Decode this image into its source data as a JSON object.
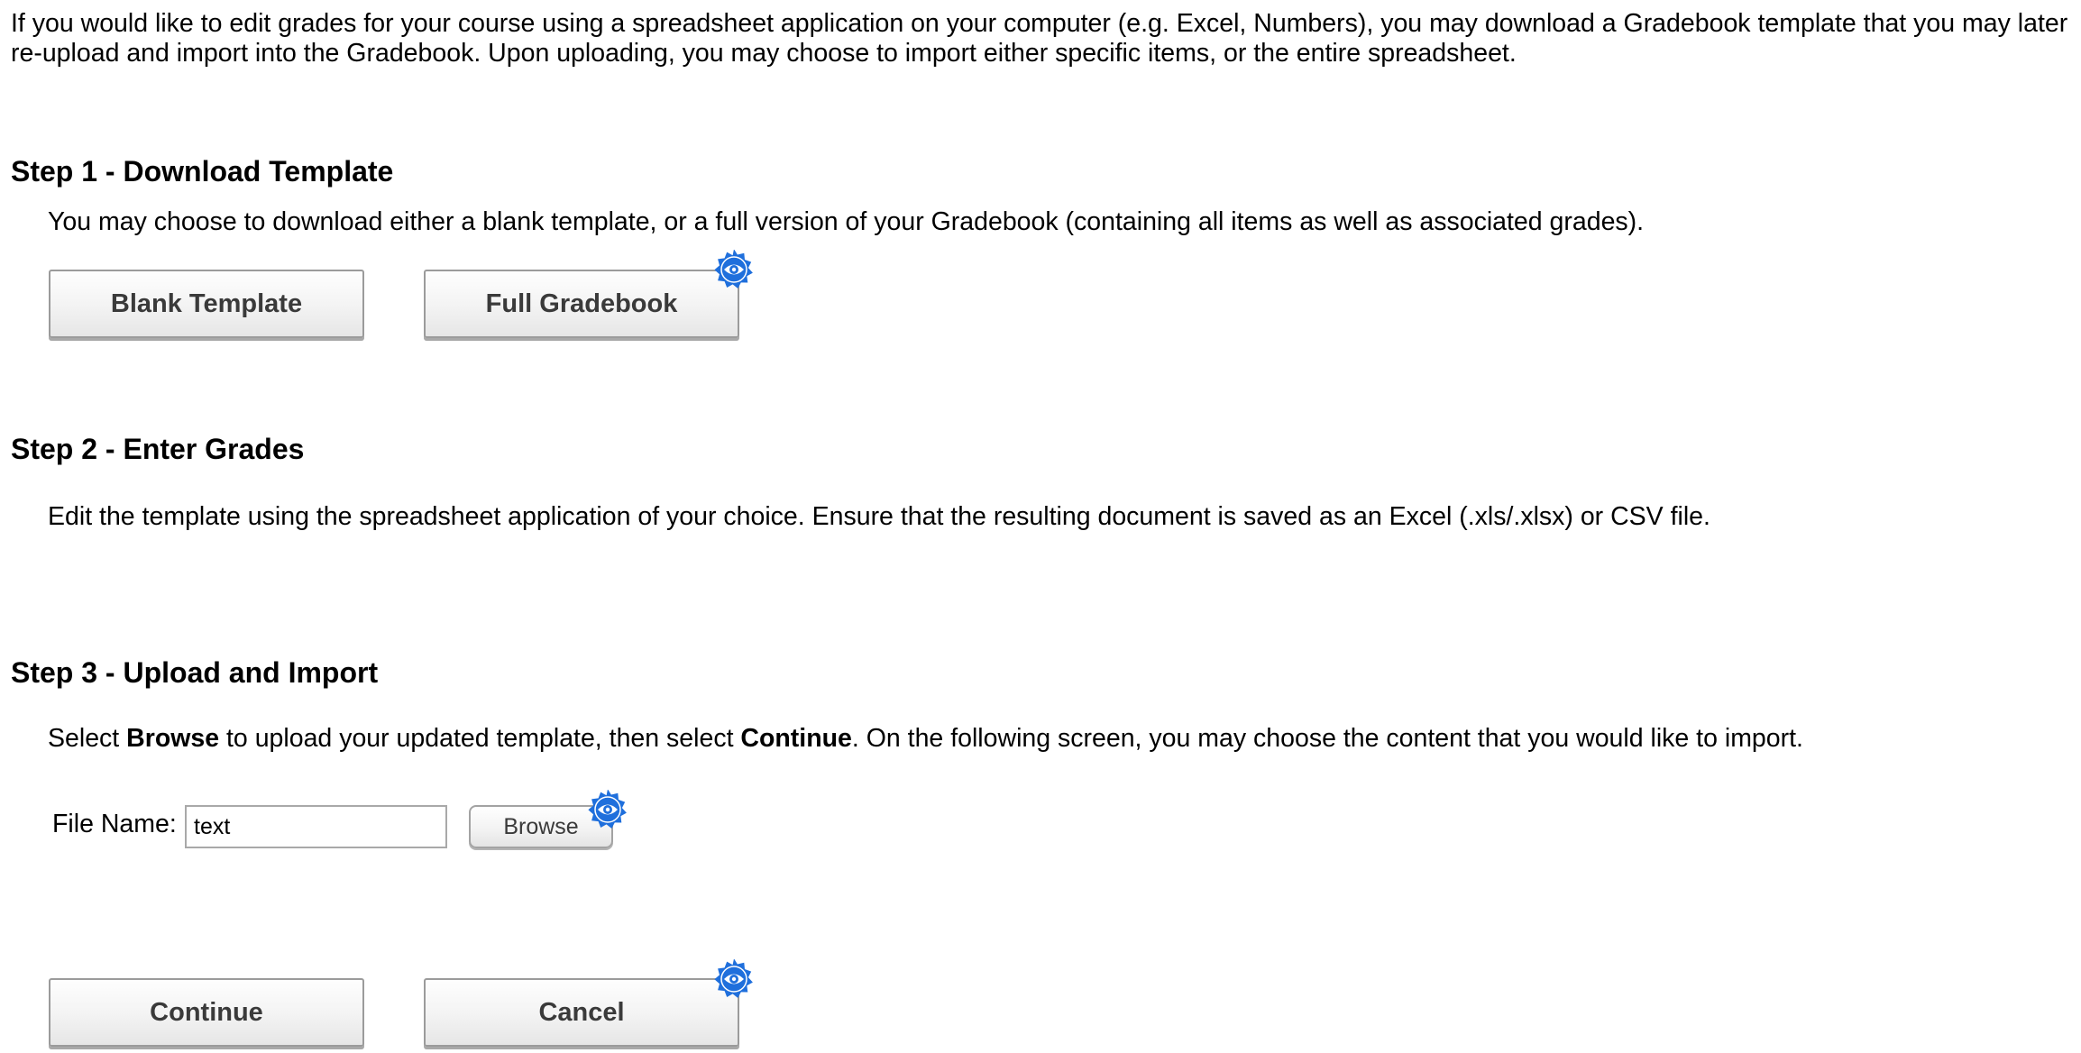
{
  "intro": {
    "text": "If you would like to edit grades for your course using a spreadsheet application on your computer (e.g. Excel, Numbers), you may download a Gradebook template that you may later re-upload and import into the Gradebook. Upon uploading, you may choose to import either specific items, or the entire spreadsheet."
  },
  "step1": {
    "heading": "Step 1 - Download Template",
    "description": "You may choose to download either a blank template, or a full version of your Gradebook (containing all items as well as associated grades).",
    "blank_button": "Blank Template",
    "full_button": "Full Gradebook"
  },
  "step2": {
    "heading": "Step 2 - Enter Grades",
    "description": "Edit the template using the spreadsheet application of your choice. Ensure that the resulting document is saved as an Excel (.xls/.xlsx) or CSV file."
  },
  "step3": {
    "heading": "Step 3 - Upload and Import",
    "desc_part1": "Select ",
    "desc_browse": "Browse",
    "desc_part2": " to upload your updated template, then select ",
    "desc_continue": "Continue",
    "desc_part3": ". On the following screen, you may choose the content that you would like to import.",
    "file_label": "File Name:",
    "file_value": "text",
    "browse_button": "Browse"
  },
  "actions": {
    "continue_button": "Continue",
    "cancel_button": "Cancel"
  },
  "icons": {
    "badge": "eye-badge-icon",
    "badge_color": "#1f6fdc"
  }
}
